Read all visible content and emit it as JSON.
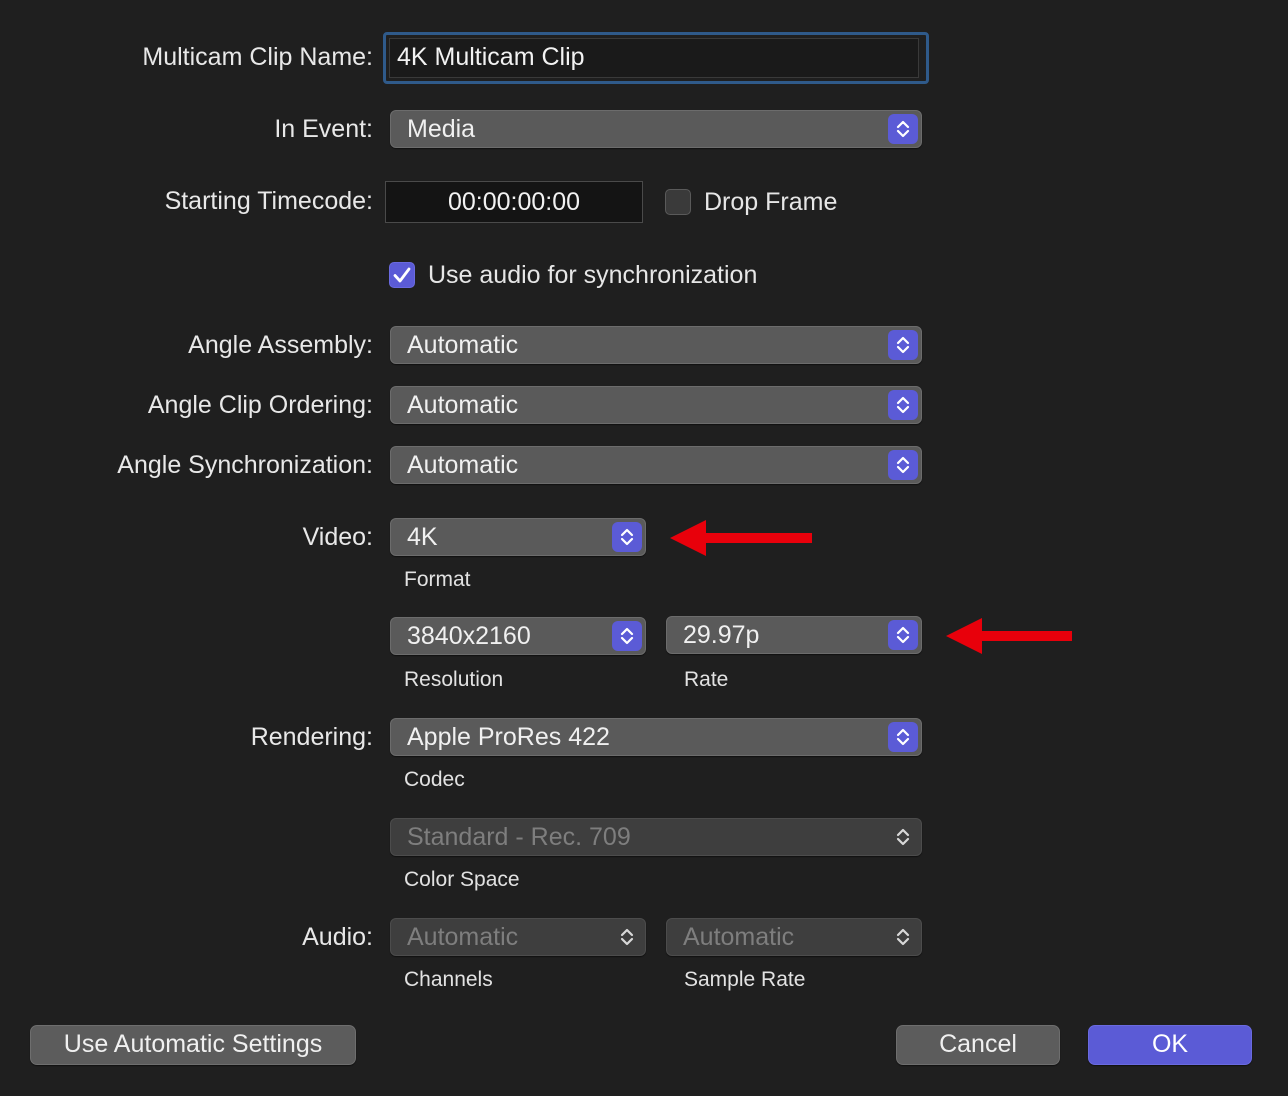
{
  "clip_name": {
    "label": "Multicam Clip Name:",
    "value": "4K Multicam Clip"
  },
  "in_event": {
    "label": "In Event:",
    "value": "Media"
  },
  "starting_timecode": {
    "label": "Starting Timecode:",
    "value": "00:00:00:00"
  },
  "drop_frame": {
    "label": "Drop Frame",
    "checked": false
  },
  "use_audio_sync": {
    "label": "Use audio for synchronization",
    "checked": true
  },
  "angle_assembly": {
    "label": "Angle Assembly:",
    "value": "Automatic"
  },
  "angle_clip_ordering": {
    "label": "Angle Clip Ordering:",
    "value": "Automatic"
  },
  "angle_synchronization": {
    "label": "Angle Synchronization:",
    "value": "Automatic"
  },
  "video": {
    "label": "Video:",
    "format": {
      "value": "4K",
      "caption": "Format"
    },
    "resolution": {
      "value": "3840x2160",
      "caption": "Resolution"
    },
    "rate": {
      "value": "29.97p",
      "caption": "Rate"
    }
  },
  "rendering": {
    "label": "Rendering:",
    "codec": {
      "value": "Apple ProRes 422",
      "caption": "Codec"
    },
    "color_space": {
      "value": "Standard - Rec. 709",
      "caption": "Color Space",
      "disabled": true
    }
  },
  "audio": {
    "label": "Audio:",
    "channels": {
      "value": "Automatic",
      "caption": "Channels",
      "disabled": true
    },
    "sample_rate": {
      "value": "Automatic",
      "caption": "Sample Rate",
      "disabled": true
    }
  },
  "buttons": {
    "use_automatic": "Use Automatic Settings",
    "cancel": "Cancel",
    "ok": "OK"
  },
  "colors": {
    "accent": "#5b5bd6",
    "annotation_arrow": "#e8000b",
    "background": "#1f1f1f"
  },
  "icons": [
    "updown-chevron-icon",
    "checkmark-icon",
    "red-arrow-annotation"
  ]
}
